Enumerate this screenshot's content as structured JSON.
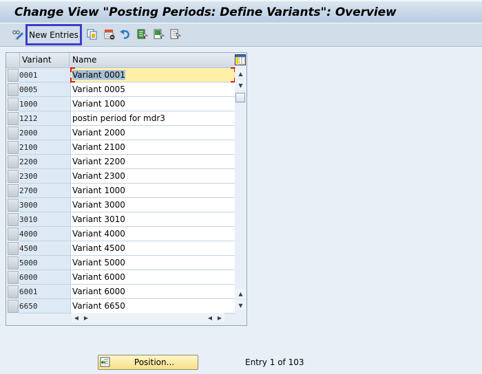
{
  "window": {
    "title": "Change View \"Posting Periods: Define Variants\": Overview"
  },
  "toolbar": {
    "icons": [
      {
        "name": "display-change-icon",
        "title": "Display -> Change"
      },
      {
        "name": "copy-as-icon",
        "title": "Copy As..."
      },
      {
        "name": "delete-icon",
        "title": "Delete"
      },
      {
        "name": "undo-icon",
        "title": "Undo Change"
      },
      {
        "name": "select-all-icon",
        "title": "Select All"
      },
      {
        "name": "select-block-icon",
        "title": "Select Block"
      },
      {
        "name": "deselect-all-icon",
        "title": "Deselect All"
      }
    ],
    "new_entries_label": "New Entries"
  },
  "table": {
    "columns": [
      "Variant",
      "Name"
    ],
    "rows": [
      {
        "variant": "0001",
        "name": "Variant 0001",
        "active": true
      },
      {
        "variant": "0005",
        "name": "Variant 0005"
      },
      {
        "variant": "1000",
        "name": "Variant 1000"
      },
      {
        "variant": "1212",
        "name": "postin period for mdr3"
      },
      {
        "variant": "2000",
        "name": "Variant 2000"
      },
      {
        "variant": "2100",
        "name": "Variant 2100"
      },
      {
        "variant": "2200",
        "name": "Variant 2200"
      },
      {
        "variant": "2300",
        "name": "Variant 2300"
      },
      {
        "variant": "2700",
        "name": "Variant 1000"
      },
      {
        "variant": "3000",
        "name": "Variant 3000"
      },
      {
        "variant": "3010",
        "name": "Variant 3010"
      },
      {
        "variant": "4000",
        "name": "Variant 4000"
      },
      {
        "variant": "4500",
        "name": "Variant 4500"
      },
      {
        "variant": "5000",
        "name": "Variant 5000"
      },
      {
        "variant": "6000",
        "name": "Variant 6000"
      },
      {
        "variant": "6001",
        "name": "Variant 6000"
      },
      {
        "variant": "6650",
        "name": "Variant 6650"
      }
    ]
  },
  "footer": {
    "position_label": "Position...",
    "entry_info": "Entry 1 of 103"
  }
}
